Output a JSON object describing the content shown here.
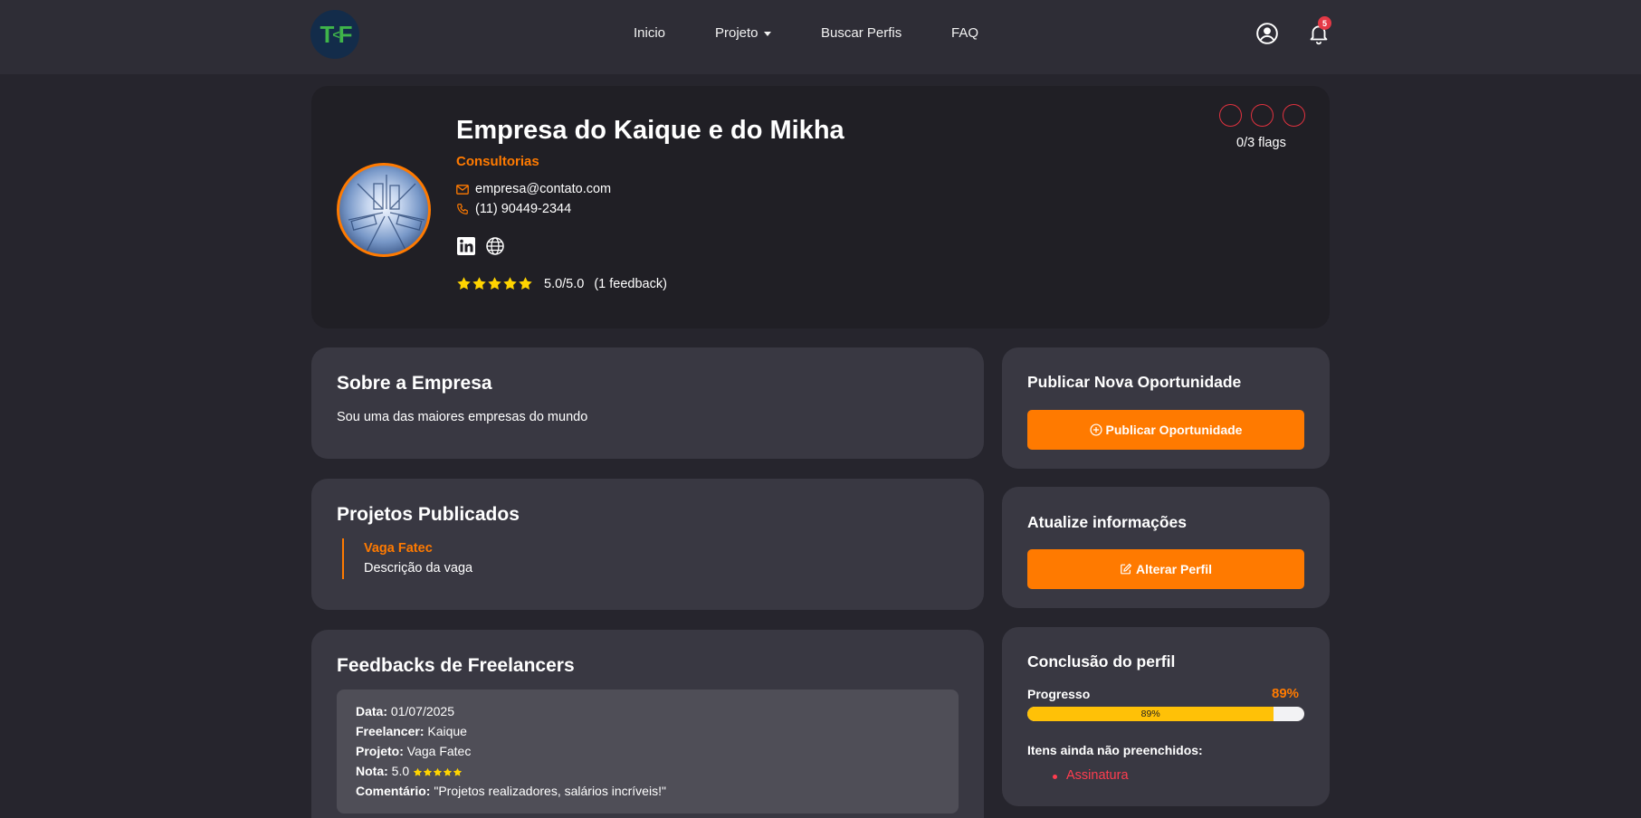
{
  "nav": {
    "logo_main": "T",
    "logo_mid": "<",
    "logo_end": "F",
    "links": [
      "Inicio",
      "Projeto",
      "Buscar Perfis",
      "FAQ"
    ],
    "notification_count": "5",
    "icons": [
      "user-circle-icon",
      "bell-icon"
    ]
  },
  "profile": {
    "name": "Empresa do Kaique e do Mikha",
    "category": "Consultorias",
    "email": "empresa@contato.com",
    "phone": "(11) 90449-2344",
    "social_icons": [
      "linkedin-icon",
      "globe-icon"
    ],
    "rating_stars": 5,
    "rating_text": "5.0/5.0",
    "feedback_count": "(1 feedback)",
    "flags_label": "0/3 flags",
    "flags_count": 3
  },
  "about": {
    "title": "Sobre a Empresa",
    "text": "Sou uma das maiores empresas do mundo"
  },
  "projects": {
    "title": "Projetos Publicados",
    "items": [
      {
        "title": "Vaga Fatec",
        "description": "Descrição da vaga"
      }
    ]
  },
  "feedbacks": {
    "title": "Feedbacks de Freelancers",
    "items": [
      {
        "date_label": "Data:",
        "date": "01/07/2025",
        "freelancer_label": "Freelancer:",
        "freelancer": "Kaique",
        "project_label": "Projeto:",
        "project": "Vaga Fatec",
        "grade_label": "Nota:",
        "grade": "5.0",
        "grade_stars": 5,
        "comment_label": "Comentário:",
        "comment": "\"Projetos realizadores, salários incríveis!\""
      }
    ]
  },
  "publish": {
    "title": "Publicar Nova Oportunidade",
    "button": "Publicar Oportunidade"
  },
  "update": {
    "title": "Atualize informações",
    "button": "Alterar Perfil"
  },
  "completion": {
    "title": "Conclusão do perfil",
    "progress_label": "Progresso",
    "progress_text": "89%",
    "progress_value": 0.89,
    "missing_label": "Itens ainda não preenchidos:",
    "missing_items": [
      "Assinatura"
    ]
  },
  "colors": {
    "accent": "#ff7a00",
    "background": "#26252d",
    "card": "#393842",
    "progress": "#ffc107",
    "danger": "#ff3d4f"
  }
}
